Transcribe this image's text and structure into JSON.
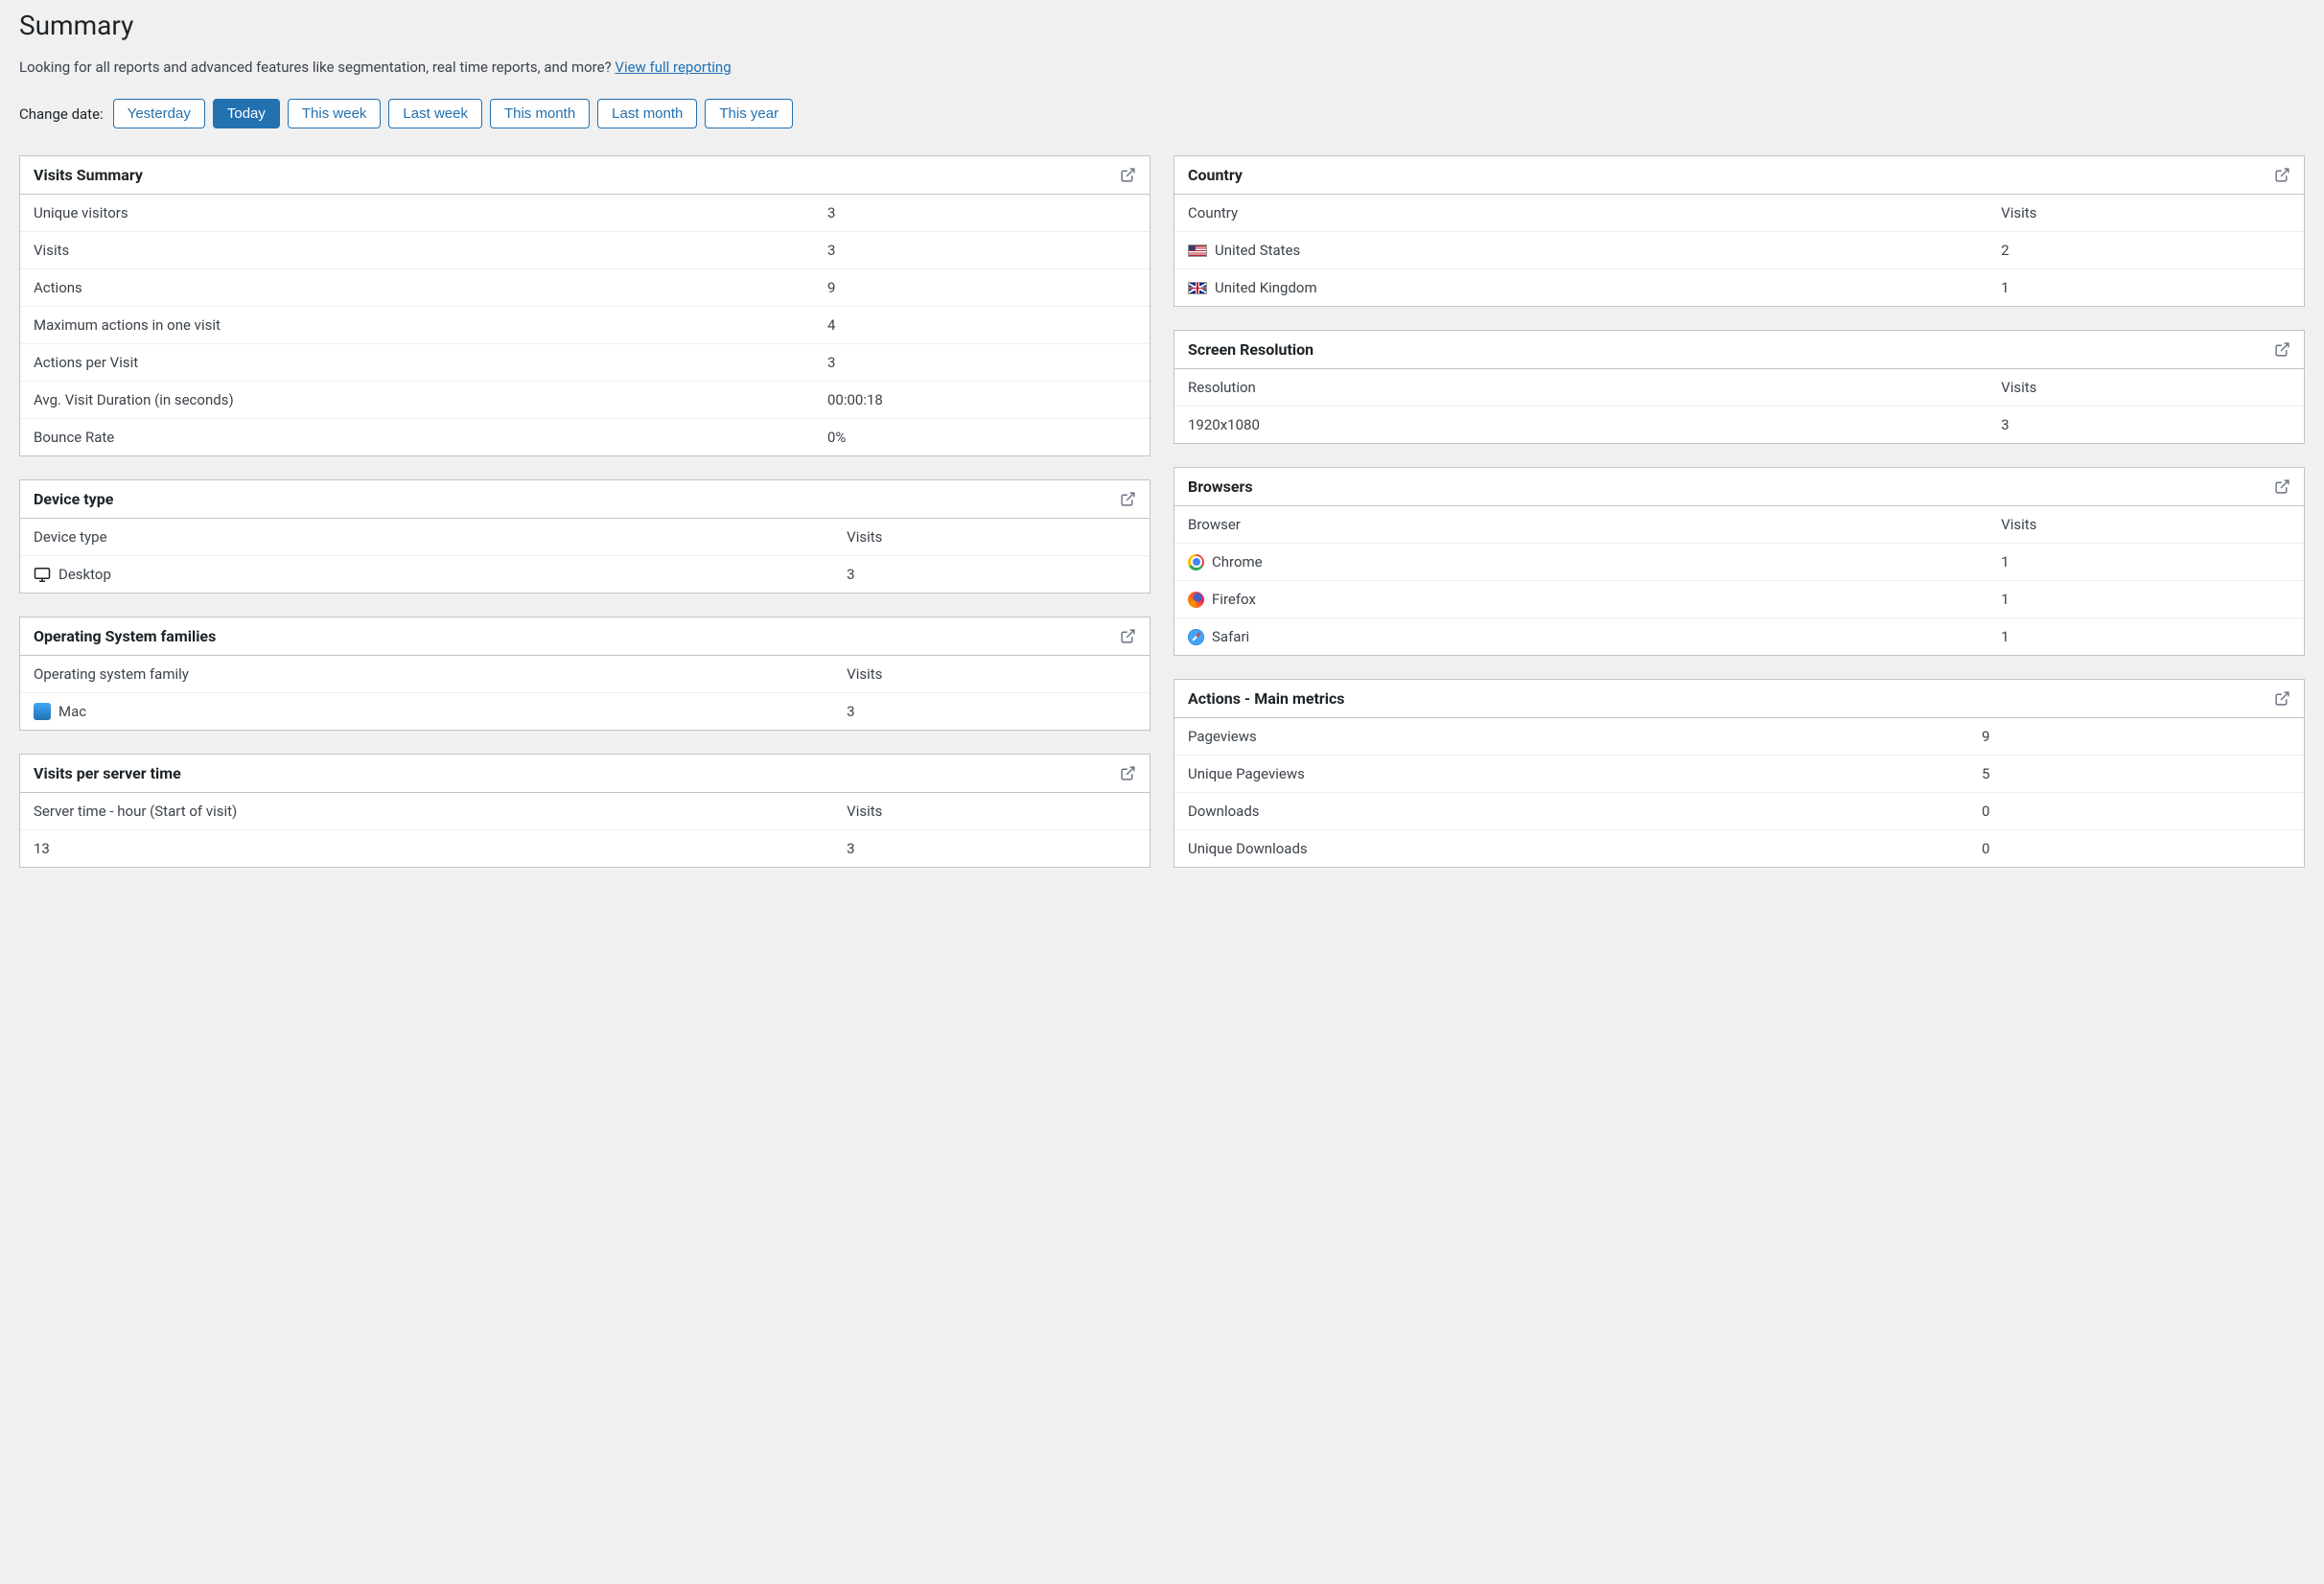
{
  "page_title": "Summary",
  "intro_text": "Looking for all reports and advanced features like segmentation, real time reports, and more? ",
  "intro_link": "View full reporting",
  "change_date_label": "Change date:",
  "date_buttons": {
    "yesterday": "Yesterday",
    "today": "Today",
    "this_week": "This week",
    "last_week": "Last week",
    "this_month": "This month",
    "last_month": "Last month",
    "this_year": "This year",
    "active": "today"
  },
  "cards": {
    "visits_summary": {
      "title": "Visits Summary",
      "rows": [
        {
          "label": "Unique visitors",
          "value": "3"
        },
        {
          "label": "Visits",
          "value": "3"
        },
        {
          "label": "Actions",
          "value": "9"
        },
        {
          "label": "Maximum actions in one visit",
          "value": "4"
        },
        {
          "label": "Actions per Visit",
          "value": "3"
        },
        {
          "label": "Avg. Visit Duration (in seconds)",
          "value": "00:00:18"
        },
        {
          "label": "Bounce Rate",
          "value": "0%"
        }
      ]
    },
    "device_type": {
      "title": "Device type",
      "col_key": "Device type",
      "col_val": "Visits",
      "rows": [
        {
          "icon": "desktop-icon",
          "label": "Desktop",
          "value": "3"
        }
      ]
    },
    "os_families": {
      "title": "Operating System families",
      "col_key": "Operating system family",
      "col_val": "Visits",
      "rows": [
        {
          "icon": "mac-icon",
          "label": "Mac",
          "value": "3"
        }
      ]
    },
    "visits_per_server_time": {
      "title": "Visits per server time",
      "col_key": "Server time - hour (Start of visit)",
      "col_val": "Visits",
      "rows": [
        {
          "label": "13",
          "value": "3"
        }
      ]
    },
    "country": {
      "title": "Country",
      "col_key": "Country",
      "col_val": "Visits",
      "rows": [
        {
          "icon": "flag-us-icon",
          "label": "United States",
          "value": "2"
        },
        {
          "icon": "flag-uk-icon",
          "label": "United Kingdom",
          "value": "1"
        }
      ]
    },
    "screen_resolution": {
      "title": "Screen Resolution",
      "col_key": "Resolution",
      "col_val": "Visits",
      "rows": [
        {
          "label": "1920x1080",
          "value": "3"
        }
      ]
    },
    "browsers": {
      "title": "Browsers",
      "col_key": "Browser",
      "col_val": "Visits",
      "rows": [
        {
          "icon": "chrome-icon",
          "label": "Chrome",
          "value": "1"
        },
        {
          "icon": "firefox-icon",
          "label": "Firefox",
          "value": "1"
        },
        {
          "icon": "safari-icon",
          "label": "Safari",
          "value": "1"
        }
      ]
    },
    "actions_main_metrics": {
      "title": "Actions - Main metrics",
      "rows": [
        {
          "label": "Pageviews",
          "value": "9"
        },
        {
          "label": "Unique Pageviews",
          "value": "5"
        },
        {
          "label": "Downloads",
          "value": "0"
        },
        {
          "label": "Unique Downloads",
          "value": "0"
        }
      ]
    }
  }
}
